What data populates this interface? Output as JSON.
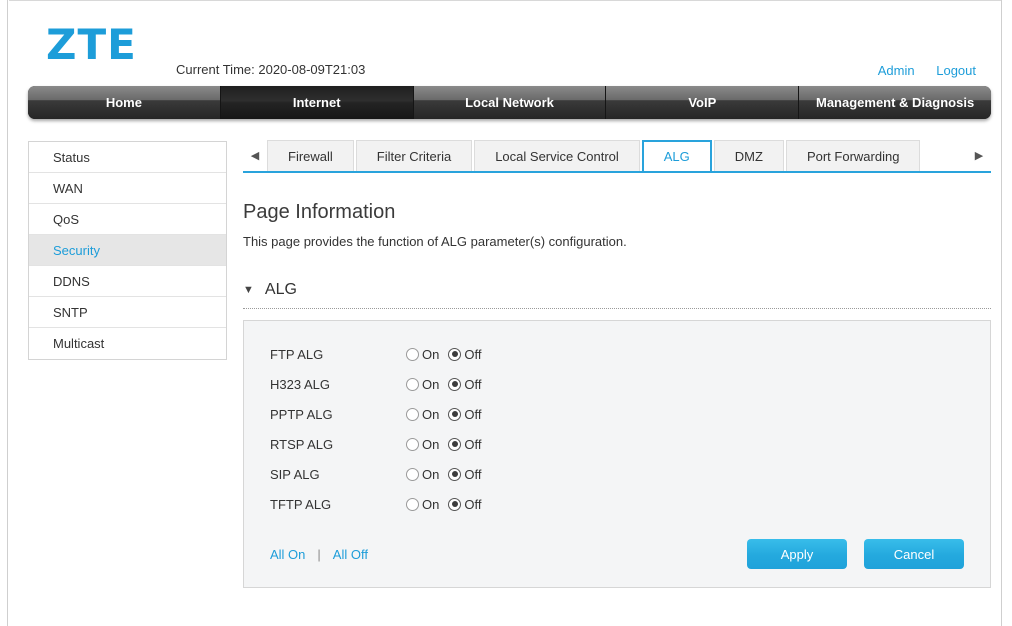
{
  "header": {
    "logo_text": "ZTE",
    "current_time": "Current Time: 2020-08-09T21:03",
    "admin_label": "Admin",
    "logout_label": "Logout"
  },
  "topnav": {
    "items": [
      {
        "label": "Home",
        "active": false
      },
      {
        "label": "Internet",
        "active": true
      },
      {
        "label": "Local Network",
        "active": false
      },
      {
        "label": "VoIP",
        "active": false
      },
      {
        "label": "Management & Diagnosis",
        "active": false
      }
    ]
  },
  "sidebar": {
    "items": [
      {
        "label": "Status",
        "active": false
      },
      {
        "label": "WAN",
        "active": false
      },
      {
        "label": "QoS",
        "active": false
      },
      {
        "label": "Security",
        "active": true
      },
      {
        "label": "DDNS",
        "active": false
      },
      {
        "label": "SNTP",
        "active": false
      },
      {
        "label": "Multicast",
        "active": false
      }
    ]
  },
  "tabs": {
    "prev_arrow": "◀",
    "next_arrow": "▶",
    "items": [
      {
        "label": "Firewall",
        "active": false
      },
      {
        "label": "Filter Criteria",
        "active": false
      },
      {
        "label": "Local Service Control",
        "active": false
      },
      {
        "label": "ALG",
        "active": true
      },
      {
        "label": "DMZ",
        "active": false
      },
      {
        "label": "Port Forwarding",
        "active": false
      }
    ]
  },
  "page_info": {
    "title": "Page Information",
    "description": "This page provides the function of ALG parameter(s) configuration."
  },
  "alg_section": {
    "caret": "▼",
    "title": "ALG",
    "option_on": "On",
    "option_off": "Off",
    "rows": [
      {
        "label": "FTP ALG",
        "value": "Off"
      },
      {
        "label": "H323 ALG",
        "value": "Off"
      },
      {
        "label": "PPTP ALG",
        "value": "Off"
      },
      {
        "label": "RTSP ALG",
        "value": "Off"
      },
      {
        "label": "SIP ALG",
        "value": "Off"
      },
      {
        "label": "TFTP ALG",
        "value": "Off"
      }
    ],
    "all_on_label": "All On",
    "separator": "|",
    "all_off_label": "All Off",
    "apply_label": "Apply",
    "cancel_label": "Cancel"
  },
  "colors": {
    "brand_blue": "#1d9dd9",
    "tab_blue": "#29a3dc",
    "button_blue": "#24a9de",
    "panel_bg": "#f4f5f6"
  }
}
